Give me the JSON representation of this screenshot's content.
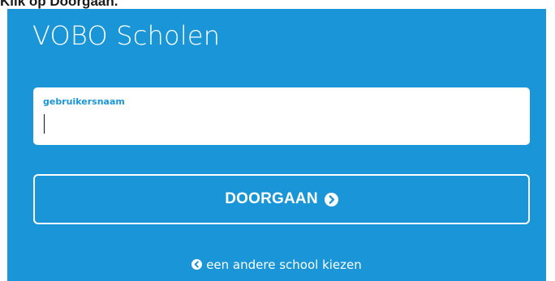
{
  "caption": {
    "text": "Klik op Doorgaan."
  },
  "app": {
    "title": "VOBO Scholen"
  },
  "login": {
    "username_label": "gebruikersnaam",
    "username_value": "",
    "continue_label": "DOORGAAN",
    "continue_icon": "chevron-circle-right-icon",
    "other_school_label": "een andere school kiezen",
    "other_school_icon": "chevron-circle-left-icon"
  },
  "colors": {
    "panel_background": "#1a96d8",
    "text_on_panel": "#ffffff",
    "field_label": "#1a96d8"
  }
}
